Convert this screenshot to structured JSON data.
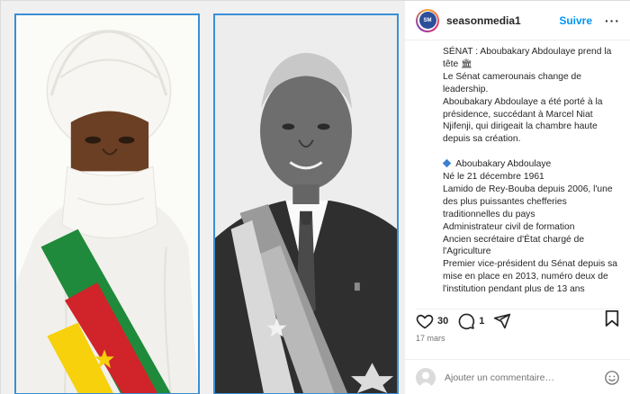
{
  "post": {
    "username": "seasonmedia1",
    "follow_label": "Suivre",
    "more_label": "···",
    "caption_lines": [
      "SÉNAT : Aboubakary Abdoulaye prend la tête",
      "Le Sénat camerounais change de leadership.",
      "Aboubakary Abdoulaye a été porté à la présidence, succédant à Marcel Niat Njifenji, qui dirigeait la chambre haute depuis sa création.",
      "Aboubakary Abdoulaye",
      "Né le 21 décembre 1961",
      "Lamido de Rey-Bouba depuis 2006, l'une des plus puissantes chefferies traditionnelles du pays",
      "Administrateur civil de formation",
      "Ancien secrétaire d'État chargé de l'Agriculture",
      "Premier vice-président du Sénat depuis sa mise en place en 2013, numéro deux de l'institution pendant plus de 13 ans"
    ],
    "title_emoji": "🏛",
    "likes_count": "30",
    "comments_count": "1",
    "date": "17 mars",
    "comment_placeholder": "Ajouter un commentaire…",
    "icons": {
      "like": "heart-icon",
      "comment": "comment-icon",
      "share": "share-icon",
      "save": "bookmark-icon",
      "emoji": "emoji-icon",
      "bullet": "blue-diamond-icon"
    },
    "colors": {
      "accent": "#0095f6",
      "photo_border": "#3a8fd6",
      "sash_green": "#1f8a3b",
      "sash_red": "#d1232a",
      "sash_yellow": "#f6d10c"
    }
  }
}
